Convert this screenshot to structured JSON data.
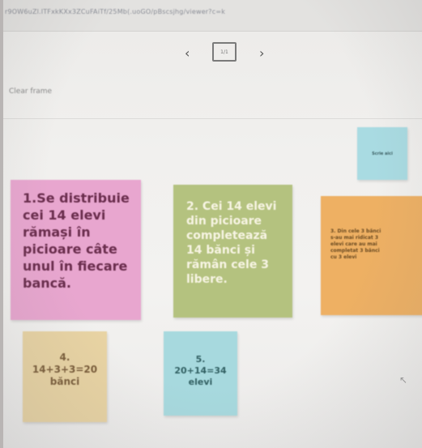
{
  "browser": {
    "url": "r9OW6uZl.lTFxkKXx3ZCuFAiTf/25Mb(.uoGO/pBscsjhg/viewer?c=k"
  },
  "frame_nav": {
    "prev": "‹",
    "next": "›",
    "thumb": "1/1"
  },
  "toolbar": {
    "clear_frame": "Clear frame"
  },
  "notes": {
    "small": "Scrie aici",
    "note1": [
      "1.Se distribuie",
      "cei 14 elevi",
      "rămași în",
      "picioare câte",
      "unul în fiecare",
      "bancă."
    ],
    "note2": [
      "2. Cei 14 elevi",
      "din picioare",
      "completează",
      "14 bănci și",
      "rămân cele 3",
      "libere."
    ],
    "note3": [
      "3. Din cele 3 bănci",
      "s-au mai ridicat 3",
      "elevi care au mai",
      "completat 3 bănci",
      "cu 3 elevi"
    ],
    "note4": [
      "4.",
      "14+3+3=20",
      "bănci"
    ],
    "note5": [
      "5.",
      "20+14=34",
      "elevi"
    ]
  },
  "colors": {
    "pink": "#e8a6cf",
    "green": "#b4c27f",
    "orange": "#eeb063",
    "tan": "#e8d3a3",
    "cyan": "#a7d9de"
  }
}
